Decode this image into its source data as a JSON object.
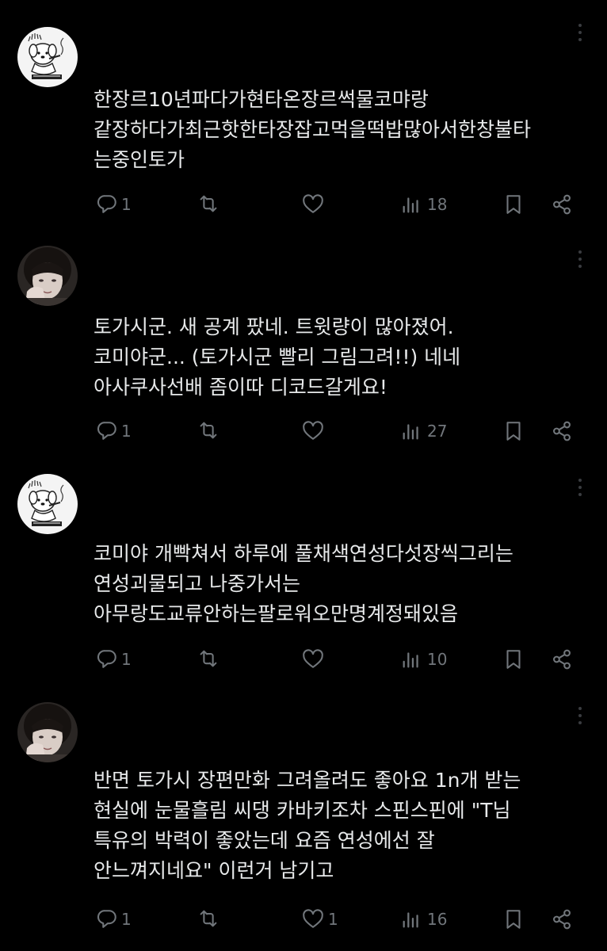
{
  "colors": {
    "background": "#000000",
    "text": "#e7e9ea",
    "icon": "#71767b",
    "menu_dots": "#3a3c40"
  },
  "posts": [
    {
      "avatar": "sketch-dog-avatar",
      "text": "한장르10년파다가현타온장르썩물코먀랑\n같장하다가최근핫한타장잡고먹을떡밥많아서한창불타\n는중인토가",
      "replies": "1",
      "reposts": "",
      "likes": "",
      "views": "18"
    },
    {
      "avatar": "photo-person-avatar",
      "text": "토가시군. 새 공계 팠네. 트윗량이 많아졌어.\n코미야군... (토가시군 빨리 그림그려!!) 네네\n아사쿠사선배 좀이따 디코드갈게요!",
      "replies": "1",
      "reposts": "",
      "likes": "",
      "views": "27"
    },
    {
      "avatar": "sketch-dog-avatar",
      "text": "코미야 개빡쳐서 하루에 풀채색연성다섯장씩그리는\n연성괴물되고 나중가서는\n아무랑도교류안하는팔로워오만명계정돼있음",
      "replies": "1",
      "reposts": "",
      "likes": "",
      "views": "10"
    },
    {
      "avatar": "photo-person-avatar",
      "text": "반면 토가시 장편만화 그려올려도 좋아요 1n개 받는\n현실에 눈물흘림 씨댕 카바키조차 스핀스핀에 \"T님\n특유의 박력이 좋았는데 요즘 연성에선 잘\n안느껴지네요\" 이런거 남기고",
      "replies": "1",
      "reposts": "",
      "likes": "1",
      "views": "16"
    }
  ]
}
